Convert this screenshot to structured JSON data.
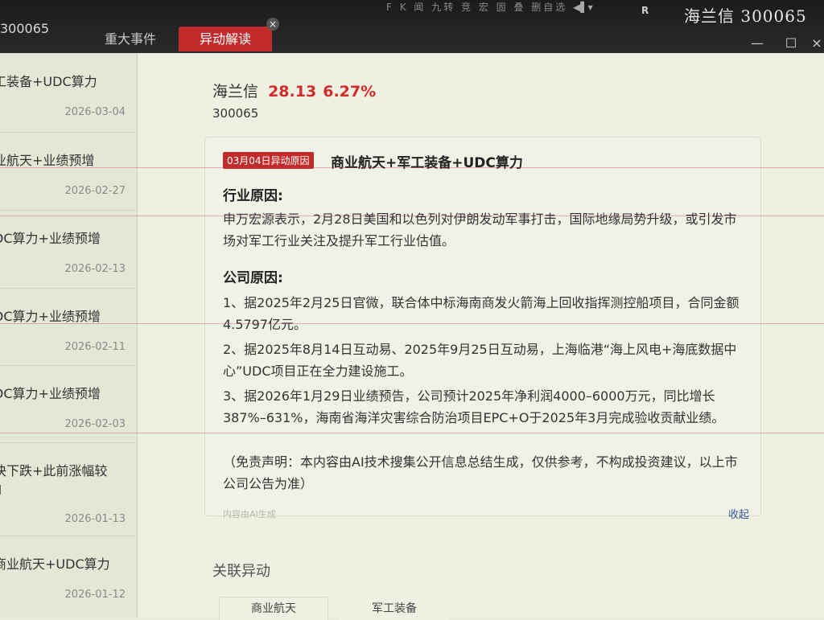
{
  "topbar": {
    "code": "300065",
    "menu": "F K  闻  九转  竞  宏  固  叠  删自选",
    "r_badge": "R",
    "stock_title": "海兰信 300065"
  },
  "tabs": {
    "events": "重大事件",
    "active": "异动解读",
    "close": "×"
  },
  "window": {
    "min": "—",
    "max": "☐",
    "close": "×"
  },
  "list": [
    {
      "title": "工装备+UDC算力",
      "date": "2026-03-04"
    },
    {
      "title": "业航天+业绩预增",
      "date": "2026-02-27"
    },
    {
      "title": "DC算力+业绩预增",
      "date": "2026-02-13"
    },
    {
      "title": "DC算力+业绩预增",
      "date": "2026-02-11"
    },
    {
      "title": "DC算力+业绩预增",
      "date": "2026-02-03"
    },
    {
      "title": "快下跌+此前涨幅较",
      "title2": "d",
      "date": "2026-01-13"
    },
    {
      "title": "商业航天+UDC算力",
      "date": "2026-01-12"
    }
  ],
  "stock": {
    "name": "海兰信",
    "price": "28.13",
    "change": "6.27%",
    "code": "300065"
  },
  "card": {
    "badge": "03月04日异动原因",
    "title": "商业航天+军工装备+UDC算力",
    "industry_heading": "行业原因:",
    "industry_text": "申万宏源表示，2月28日美国和以色列对伊朗发动军事打击，国际地缘局势升级，或引发市场对军工行业关注及提升军工行业估值。",
    "company_heading": "公司原因:",
    "item1": "1、据2025年2月25日官微，联合体中标海南商发火箭海上回收指挥测控船项目，合同金额4.5797亿元。",
    "item2": "2、据2025年8月14日互动易、2025年9月25日互动易，上海临港“海上风电+海底数据中心”UDC项目正在全力建设施工。",
    "item3": "3、据2026年1月29日业绩预告，公司预计2025年净利润4000–6000万元，同比增长387%–631%，海南省海洋灾害综合防治项目EPC+O于2025年3月完成验收贡献业绩。",
    "disclaimer": "（免责声明：本内容由AI技术搜集公开信息总结生成，仅供参考，不构成投资建议，以上市公司公告为准）",
    "ai_note": "内容由AI生成",
    "collapse": "收起"
  },
  "related": {
    "heading": "关联异动",
    "tags": [
      "商业航天",
      "军工装备"
    ]
  }
}
